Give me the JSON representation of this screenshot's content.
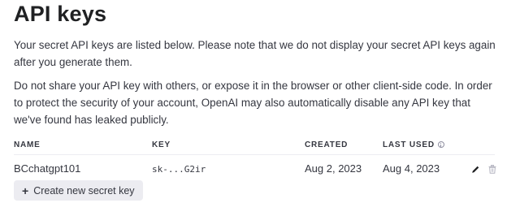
{
  "page": {
    "title": "API keys",
    "para1": "Your secret API keys are listed below. Please note that we do not display your secret API keys again after you generate them.",
    "para2": "Do not share your API key with others, or expose it in the browser or other client-side code. In order to protect the security of your account, OpenAI may also automatically disable any API key that we've found has leaked publicly."
  },
  "table": {
    "headers": {
      "name": "NAME",
      "key": "KEY",
      "created": "CREATED",
      "last_used": "LAST USED"
    },
    "rows": [
      {
        "name": "BCchatgpt101",
        "key": "sk-...G2ir",
        "created": "Aug 2, 2023",
        "last_used": "Aug 4, 2023"
      }
    ]
  },
  "actions": {
    "create_label": "Create new secret key",
    "create_icon": "plus-icon",
    "edit_icon": "pencil-icon",
    "delete_icon": "trash-icon",
    "info_icon": "info-icon"
  },
  "colors": {
    "text": "#353740",
    "heading": "#202123",
    "button_bg": "#ececf1",
    "muted": "#8e8ea0"
  }
}
